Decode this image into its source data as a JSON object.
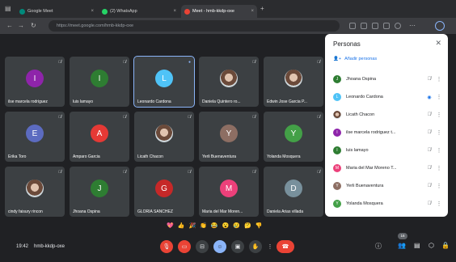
{
  "browser": {
    "tabs": [
      {
        "label": "Google Meet",
        "active": false
      },
      {
        "label": "(2) WhatsApp",
        "active": false
      },
      {
        "label": "Meet - hmb-kkdp-oxe",
        "active": true
      }
    ],
    "url": "https://meet.google.com/hmb-kkdp-oxe"
  },
  "tiles": [
    {
      "name": "ilse marcela rodriguez",
      "initial": "I",
      "color": "#8e24aa",
      "kind": "initial"
    },
    {
      "name": "luis lamayo",
      "initial": "I",
      "color": "#2e7d32",
      "kind": "initial"
    },
    {
      "name": "Leonardo Cardona",
      "initial": "L",
      "color": "#4fc3f7",
      "kind": "initial",
      "speaking": true
    },
    {
      "name": "Daniela Quintero ro...",
      "initial": "",
      "color": "#8d6e63",
      "kind": "photo"
    },
    {
      "name": "Edwin Jose Garcia P...",
      "initial": "",
      "color": "#5d4037",
      "kind": "photo"
    },
    {
      "name": "Erika Toro",
      "initial": "E",
      "color": "#5c6bc0",
      "kind": "initial"
    },
    {
      "name": "Amparo Garcia",
      "initial": "A",
      "color": "#e53935",
      "kind": "initial"
    },
    {
      "name": "Licath Chacon",
      "initial": "",
      "color": "#6d4c41",
      "kind": "photo"
    },
    {
      "name": "Yerli Buenaventura",
      "initial": "Y",
      "color": "#8d6e63",
      "kind": "initial"
    },
    {
      "name": "Yolanda Mosquera",
      "initial": "Y",
      "color": "#43a047",
      "kind": "initial"
    },
    {
      "name": "cindy faisury rincon",
      "initial": "",
      "color": "#c2185b",
      "kind": "photo"
    },
    {
      "name": "Jhoana Ospina",
      "initial": "J",
      "color": "#2e7d32",
      "kind": "initial"
    },
    {
      "name": "GLORIA SANCHEZ",
      "initial": "G",
      "color": "#c62828",
      "kind": "initial"
    },
    {
      "name": "Maria del Mar Moren...",
      "initial": "M",
      "color": "#ec407a",
      "kind": "initial"
    },
    {
      "name": "Daniela Arias villada",
      "initial": "D",
      "color": "#78909c",
      "kind": "initial"
    }
  ],
  "panel": {
    "title": "Personas",
    "add_label": "Añadir personas",
    "participants": [
      {
        "name": "Jhoana Ospina",
        "initial": "J",
        "color": "#2e7d32"
      },
      {
        "name": "Leonardo Cardona",
        "initial": "L",
        "color": "#4fc3f7"
      },
      {
        "name": "Licath Chacon",
        "initial": "",
        "color": "#6d4c41"
      },
      {
        "name": "ilse marcela rodriguez t...",
        "initial": "I",
        "color": "#8e24aa"
      },
      {
        "name": "luis lamayo",
        "initial": "I",
        "color": "#2e7d32"
      },
      {
        "name": "Maria del Mar Moreno T...",
        "initial": "M",
        "color": "#ec407a"
      },
      {
        "name": "Yerli Buenaventura",
        "initial": "Y",
        "color": "#8d6e63"
      },
      {
        "name": "Yolanda Mosquera",
        "initial": "Y",
        "color": "#43a047"
      }
    ]
  },
  "reactions": [
    "💖",
    "👍",
    "🎉",
    "👏",
    "😂",
    "😮",
    "😢",
    "🤔",
    "👎"
  ],
  "bottom": {
    "time": "19:42",
    "meeting_code": "hmb-kkdp-oxe",
    "participant_count": "16"
  }
}
